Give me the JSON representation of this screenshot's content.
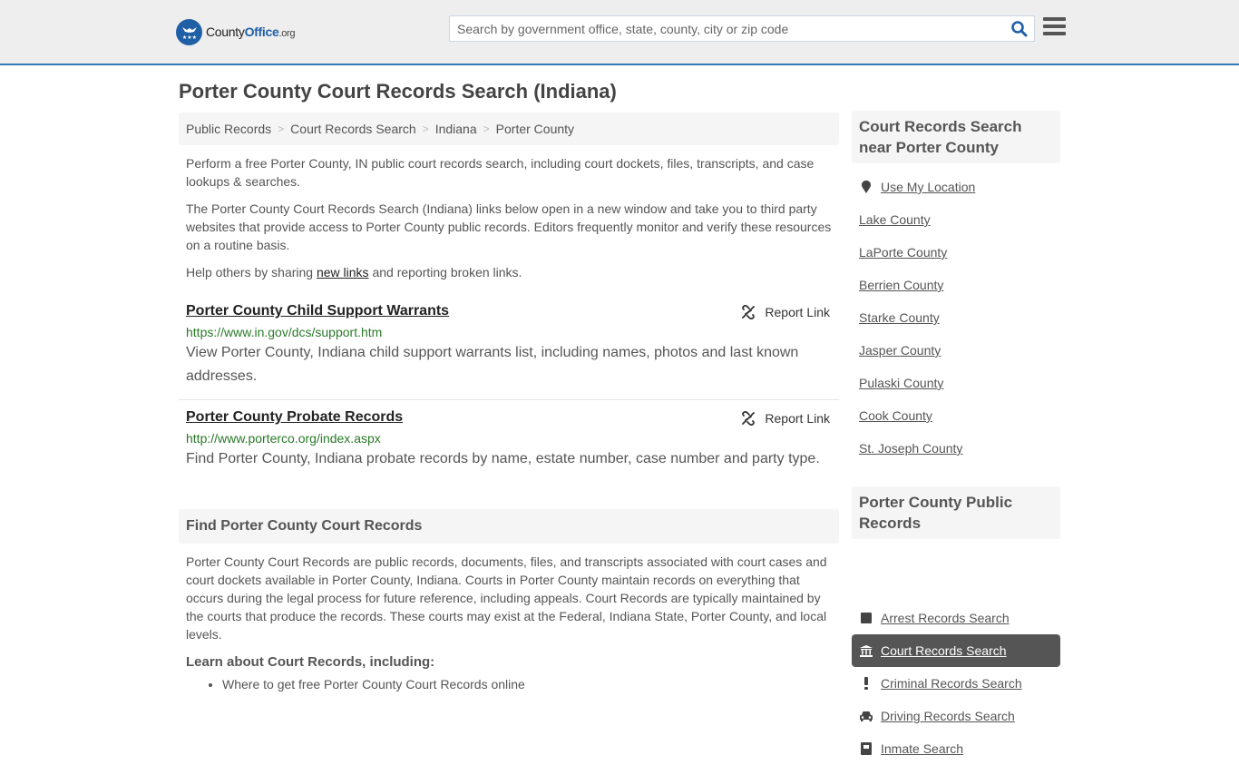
{
  "header": {
    "logo": {
      "county": "County",
      "office": "Office",
      "org": ".org"
    },
    "search_placeholder": "Search by government office, state, county, city or zip code",
    "search_icon": "magnifier-icon",
    "menu_icon": "hamburger-icon"
  },
  "page": {
    "title": "Porter County Court Records Search (Indiana)",
    "breadcrumb": [
      "Public Records",
      "Court Records Search",
      "Indiana",
      "Porter County"
    ],
    "intro": [
      "Perform a free Porter County, IN public court records search, including court dockets, files, transcripts, and case lookups & searches.",
      "The Porter County Court Records Search (Indiana) links below open in a new window and take you to third party websites that provide access to Porter County public records. Editors frequently monitor and verify these resources on a routine basis."
    ],
    "help": {
      "before": "Help others by sharing ",
      "link": "new links",
      "after": " and reporting broken links."
    },
    "results": [
      {
        "title": "Porter County Child Support Warrants",
        "url": "https://www.in.gov/dcs/support.htm",
        "description": "View Porter County, Indiana child support warrants list, including names, photos and last known addresses.",
        "report_label": "Report Link"
      },
      {
        "title": "Porter County Probate Records",
        "url": "http://www.porterco.org/index.aspx",
        "description": "Find Porter County, Indiana probate records by name, estate number, case number and party type.",
        "report_label": "Report Link"
      }
    ],
    "find_section": {
      "heading": "Find Porter County Court Records",
      "body": "Porter County Court Records are public records, documents, files, and transcripts associated with court cases and court dockets available in Porter County, Indiana. Courts in Porter County maintain records on everything that occurs during the legal process for future reference, including appeals. Court Records are typically maintained by the courts that produce the records. These courts may exist at the Federal, Indiana State, Porter County, and local levels.",
      "learn_heading": "Learn about Court Records, including:",
      "bullets": [
        "Where to get free Porter County Court Records online"
      ]
    }
  },
  "sidebar": {
    "nearby": {
      "heading": "Court Records Search near Porter County",
      "use_location": "Use My Location",
      "counties": [
        "Lake County",
        "LaPorte County",
        "Berrien County",
        "Starke County",
        "Jasper County",
        "Pulaski County",
        "Cook County",
        "St. Joseph County"
      ]
    },
    "public_records": {
      "heading": "Porter County Public Records",
      "items": [
        {
          "label": "Arrest Records Search",
          "icon": "square-icon",
          "active": false
        },
        {
          "label": "Court Records Search",
          "icon": "courthouse-icon",
          "active": true
        },
        {
          "label": "Criminal Records Search",
          "icon": "exclamation-icon",
          "active": false
        },
        {
          "label": "Driving Records Search",
          "icon": "car-icon",
          "active": false
        },
        {
          "label": "Inmate Search",
          "icon": "inmate-icon",
          "active": false
        }
      ]
    }
  }
}
